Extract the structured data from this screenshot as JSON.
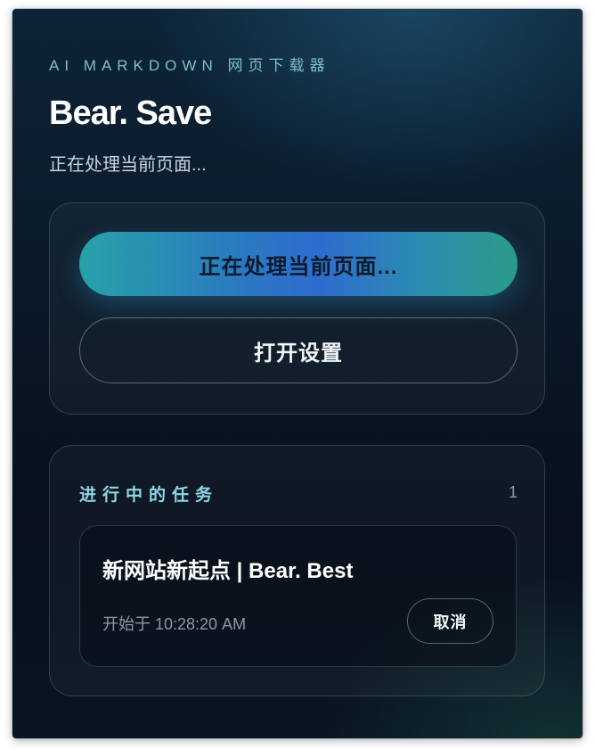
{
  "header": {
    "kicker": "AI MARKDOWN 网页下载器",
    "title": "Bear. Save",
    "subtitle": "正在处理当前页面..."
  },
  "actions": {
    "primary_label": "正在处理当前页面...",
    "settings_label": "打开设置"
  },
  "tasks": {
    "title": "进行中的任务",
    "count": "1",
    "items": [
      {
        "name": "新网站新起点 | Bear. Best",
        "started": "开始于 10:28:20 AM",
        "cancel_label": "取消"
      }
    ]
  },
  "colors": {
    "accent_start": "#27a2a8",
    "accent_mid": "#2e6cd0",
    "accent_end": "#2b9b88",
    "kicker": "#7fbfd0",
    "section_title": "#8fd6e6",
    "background": "#0a1a2a"
  }
}
